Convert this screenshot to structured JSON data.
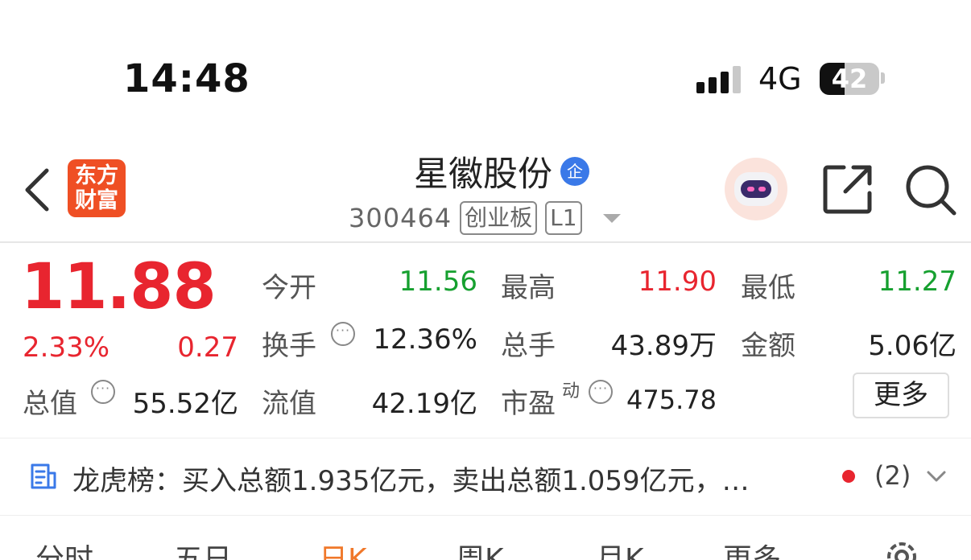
{
  "status_bar": {
    "time": "14:48",
    "network": "4G",
    "battery": "42",
    "battery_level_pct": 42
  },
  "header": {
    "logo_line1": "东方",
    "logo_line2": "财富",
    "stock_name": "星徽股份",
    "badge": "企",
    "code": "300464",
    "board_tag": "创业板",
    "level_tag": "L1"
  },
  "quote": {
    "price": "11.88",
    "change_pct": "2.33%",
    "change": "0.27",
    "stats": [
      {
        "label": "今开",
        "value": "11.56"
      },
      {
        "label": "最高",
        "value": "11.90"
      },
      {
        "label": "最低",
        "value": "11.27"
      },
      {
        "label": "换手",
        "value": "12.36%"
      },
      {
        "label": "总手",
        "value": "43.89万"
      },
      {
        "label": "金额",
        "value": "5.06亿"
      },
      {
        "label": "总值",
        "value": "55.52亿"
      },
      {
        "label": "流值",
        "value": "42.19亿"
      },
      {
        "label": "市盈",
        "value": "475.78",
        "sup": "动"
      }
    ],
    "more_label": "更多",
    "dots_glyph": "···"
  },
  "news": {
    "text": "龙虎榜：买入总额1.935亿元，卖出总额1.059亿元，…",
    "count": "(2)"
  },
  "tabs": [
    {
      "label": "分时"
    },
    {
      "label": "五日"
    },
    {
      "label": "日K",
      "active": true
    },
    {
      "label": "周K"
    },
    {
      "label": "月K"
    },
    {
      "label": "更多"
    }
  ],
  "colors": {
    "up": "#e8252f",
    "down": "#16a02f",
    "active_tab": "#f0782a",
    "brand": "#ef4f24"
  }
}
